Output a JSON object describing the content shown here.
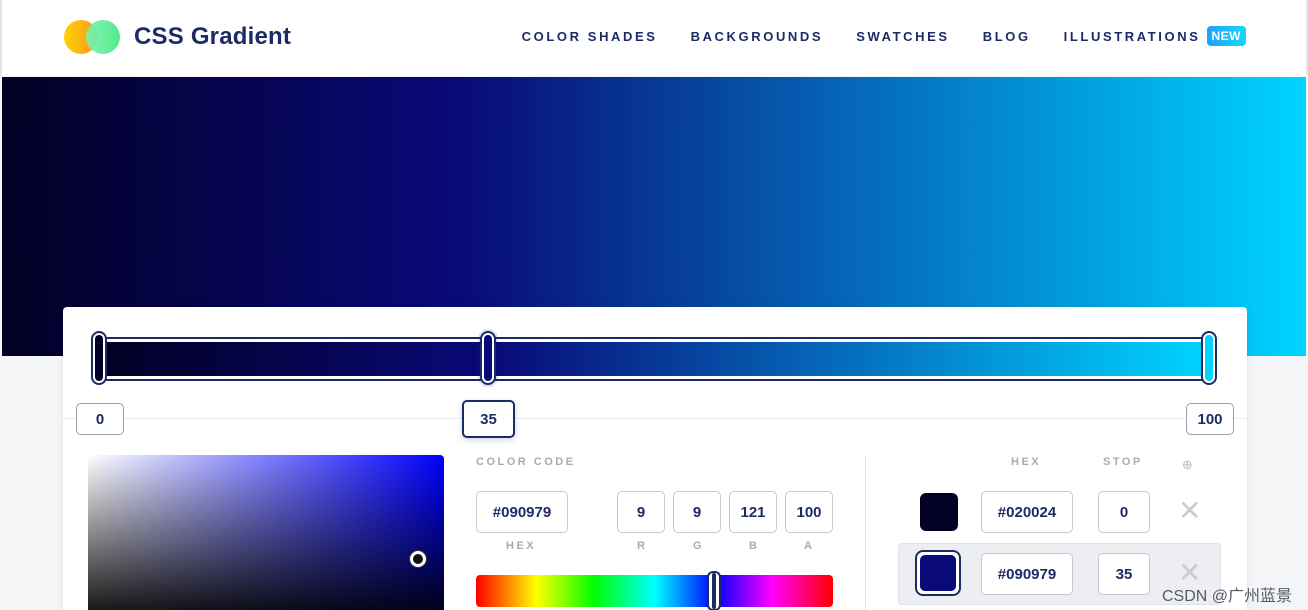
{
  "header": {
    "brand": "CSS Gradient",
    "nav": [
      {
        "label": "COLOR SHADES"
      },
      {
        "label": "BACKGROUNDS"
      },
      {
        "label": "SWATCHES"
      },
      {
        "label": "BLOG"
      },
      {
        "label": "ILLUSTRATIONS"
      }
    ],
    "badge": "NEW"
  },
  "gradient": {
    "stops": [
      {
        "color": "#020024",
        "position": "0"
      },
      {
        "color": "#090979",
        "position": "35"
      },
      {
        "color": "#00d4ff",
        "position": "100"
      }
    ],
    "active_stop": 1
  },
  "picker": {
    "color_code_label": "COLOR CODE",
    "hex_value": "#090979",
    "hex_label": "HEX",
    "r": "9",
    "g": "9",
    "b": "121",
    "a": "100",
    "r_label": "R",
    "g_label": "G",
    "b_label": "B",
    "a_label": "A"
  },
  "stop_list": {
    "hex_header": "HEX",
    "stop_header": "STOP",
    "add_icon": "⊕",
    "remove_icon": "✕",
    "rows": [
      {
        "hex": "#020024",
        "stop": "0"
      },
      {
        "hex": "#090979",
        "stop": "35"
      }
    ]
  },
  "watermark": "CSDN @广州蓝景"
}
